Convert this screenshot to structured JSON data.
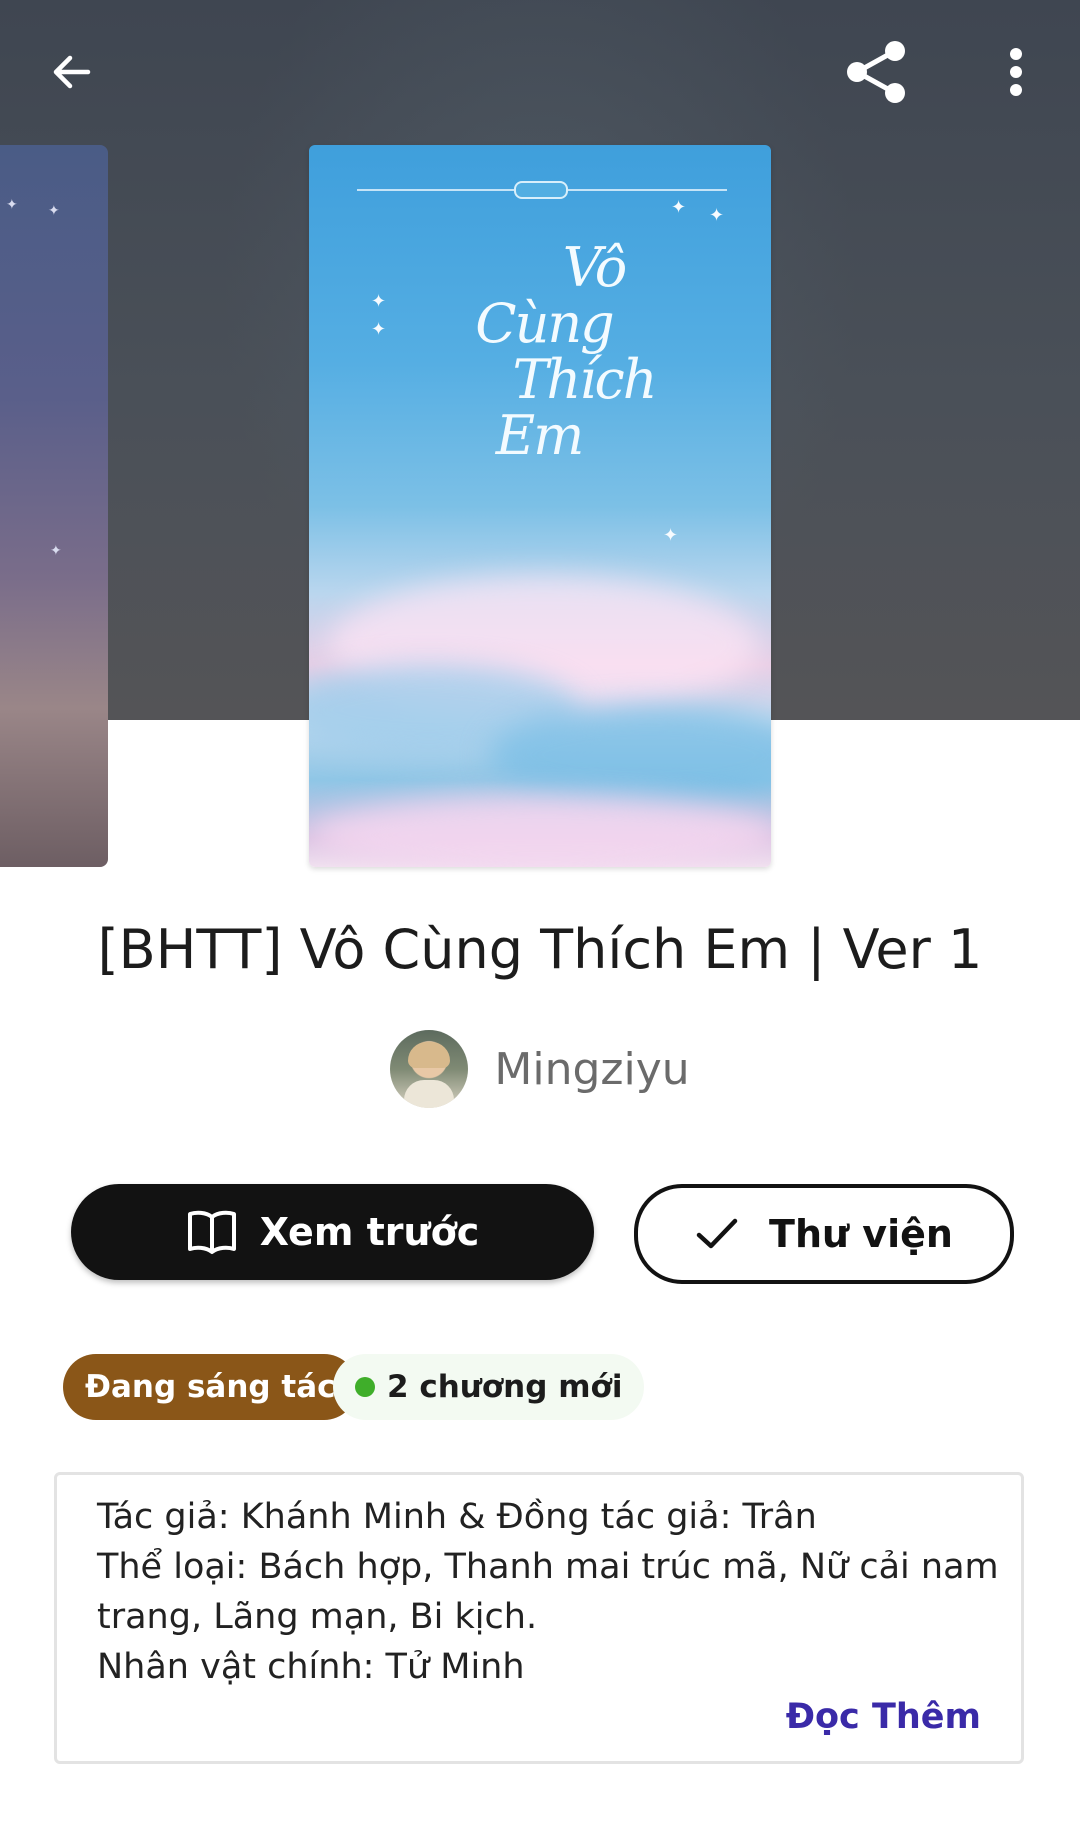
{
  "header": {
    "back_icon": "arrow-left-icon",
    "share_icon": "share-icon",
    "more_icon": "more-vertical-icon"
  },
  "cover": {
    "title_line1": "Vô",
    "title_line2": "Cùng",
    "title_line3": "Thích",
    "title_line4": "Em"
  },
  "book": {
    "title": "[BHTT] Vô Cùng Thích Em | Ver 1",
    "author": "Mingziyu"
  },
  "actions": {
    "preview_label": "Xem trước",
    "preview_icon": "book-open-icon",
    "library_label": "Thư viện",
    "library_icon": "checkmark-icon"
  },
  "badges": {
    "status": "Đang sáng tác",
    "new_chapters": "2 chương mới",
    "status_color": "#8a5618",
    "new_dot_color": "#3fae2a"
  },
  "description": {
    "lines": [
      "Tác giả: Khánh Minh & Đồng tác giả: Trân",
      "Thể loại: Bách hợp, Thanh mai trúc mã, Nữ cải nam",
      "trang, Lãng mạn, Bi kịch.",
      "Nhân vật chính: Tử Minh"
    ],
    "read_more": "Đọc Thêm",
    "read_more_color": "#3a2aa8"
  }
}
